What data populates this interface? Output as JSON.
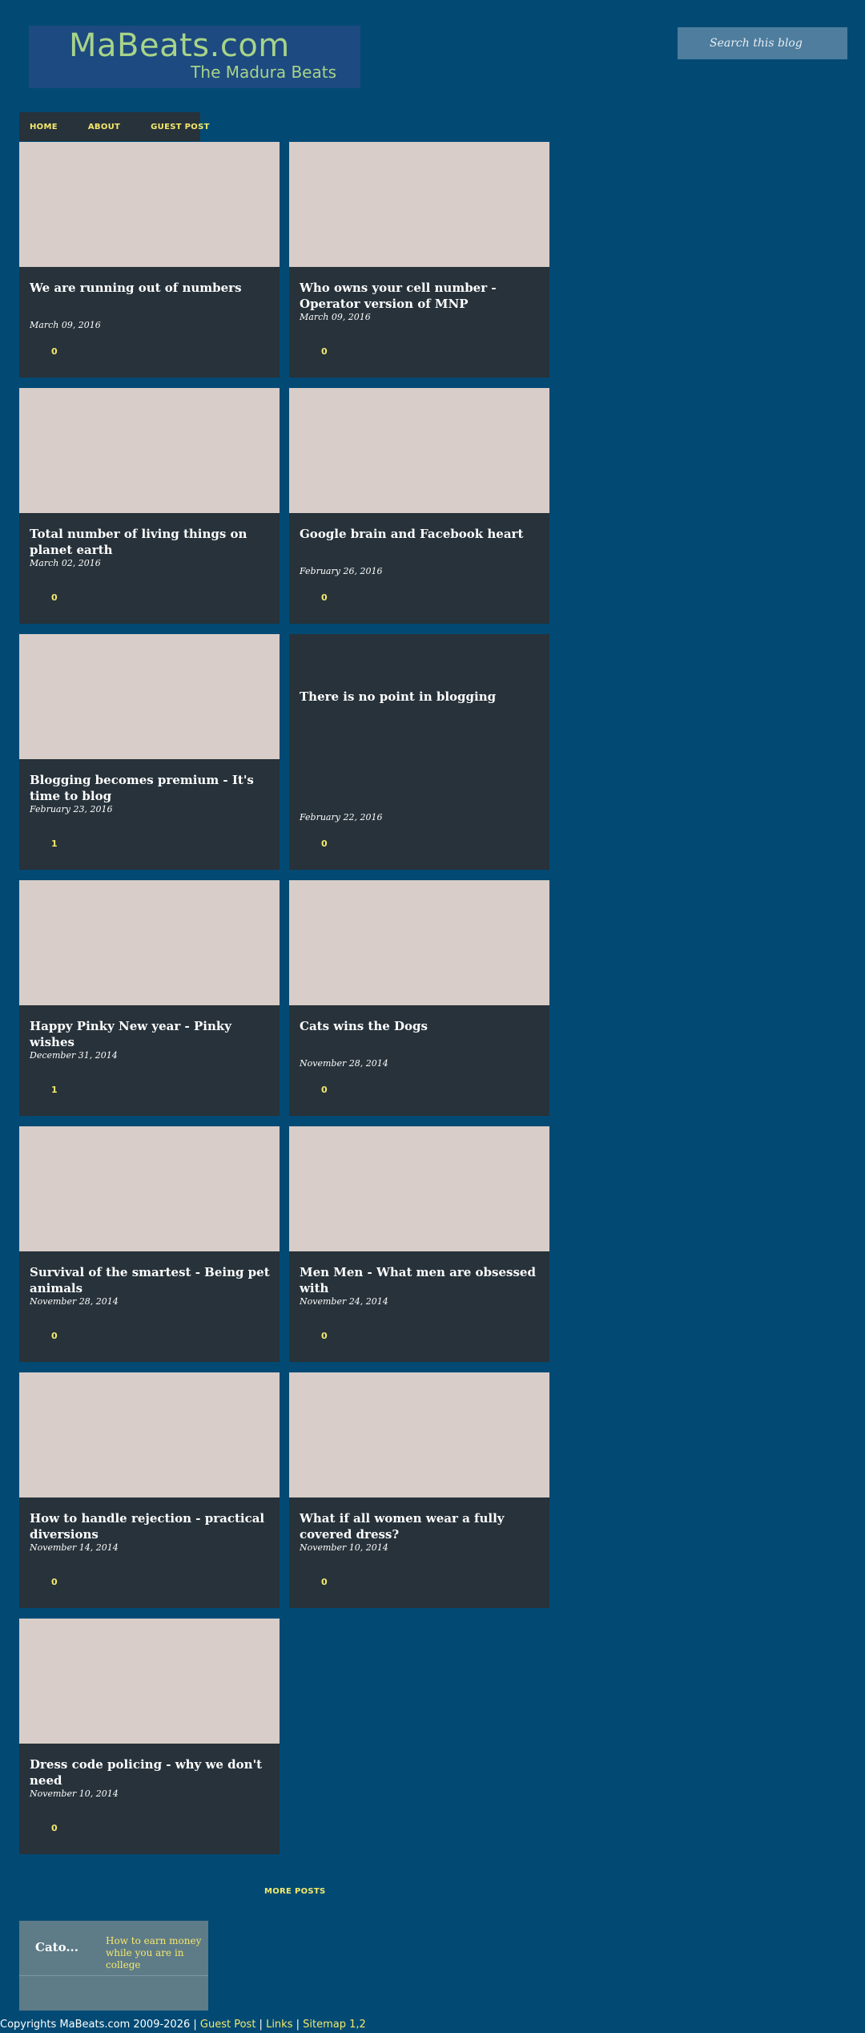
{
  "header": {
    "logo_title": "MaBeats.com",
    "logo_subtitle": "The Madura Beats"
  },
  "search": {
    "placeholder": "Search this blog"
  },
  "nav": {
    "items": [
      "HOME",
      "ABOUT",
      "GUEST POST"
    ]
  },
  "posts": [
    {
      "title": "We are running out of numbers",
      "date": "March 09, 2016",
      "comments": "0"
    },
    {
      "title": "Who owns your cell number - Operator version of MNP",
      "date": "March 09, 2016",
      "comments": "0"
    },
    {
      "title": "Total number of living things on planet earth",
      "date": "March 02, 2016",
      "comments": "0"
    },
    {
      "title": "Google brain and Facebook heart",
      "date": "February 26, 2016",
      "comments": "0"
    },
    {
      "title": "Blogging becomes premium - It's time to blog",
      "date": "February 23, 2016",
      "comments": "1"
    },
    {
      "title": "There is no point in blogging",
      "date": "February 22, 2016",
      "comments": "0"
    },
    {
      "title": "Happy Pinky New year - Pinky wishes",
      "date": "December 31, 2014",
      "comments": "1"
    },
    {
      "title": "Cats wins the Dogs",
      "date": "November 28, 2014",
      "comments": "0"
    },
    {
      "title": "Survival of the smartest - Being pet animals",
      "date": "November 28, 2014",
      "comments": "0"
    },
    {
      "title": "Men Men - What men are obsessed with",
      "date": "November 24, 2014",
      "comments": "0"
    },
    {
      "title": "How to handle rejection - practical diversions",
      "date": "November 14, 2014",
      "comments": "0"
    },
    {
      "title": "What if all women wear a fully covered dress?",
      "date": "November 10, 2014",
      "comments": "0"
    },
    {
      "title": "Dress code policing - why we don't need",
      "date": "November 10, 2014",
      "comments": "0"
    }
  ],
  "more_posts": "MORE POSTS",
  "widget": {
    "label": "Cato...",
    "link_text": "How to earn money while you are in college"
  },
  "footer": {
    "copyright": "Copyrights MaBeats.com 2009-2026",
    "sep": " | ",
    "guest_post": "Guest Post",
    "links": "Links",
    "sitemap": "Sitemap 1,2"
  },
  "colors": {
    "background": "#024a74",
    "card": "#27323a",
    "thumbnail": "#d8cdc8",
    "accent": "#f4e96b",
    "logo_text": "#a7d489"
  }
}
